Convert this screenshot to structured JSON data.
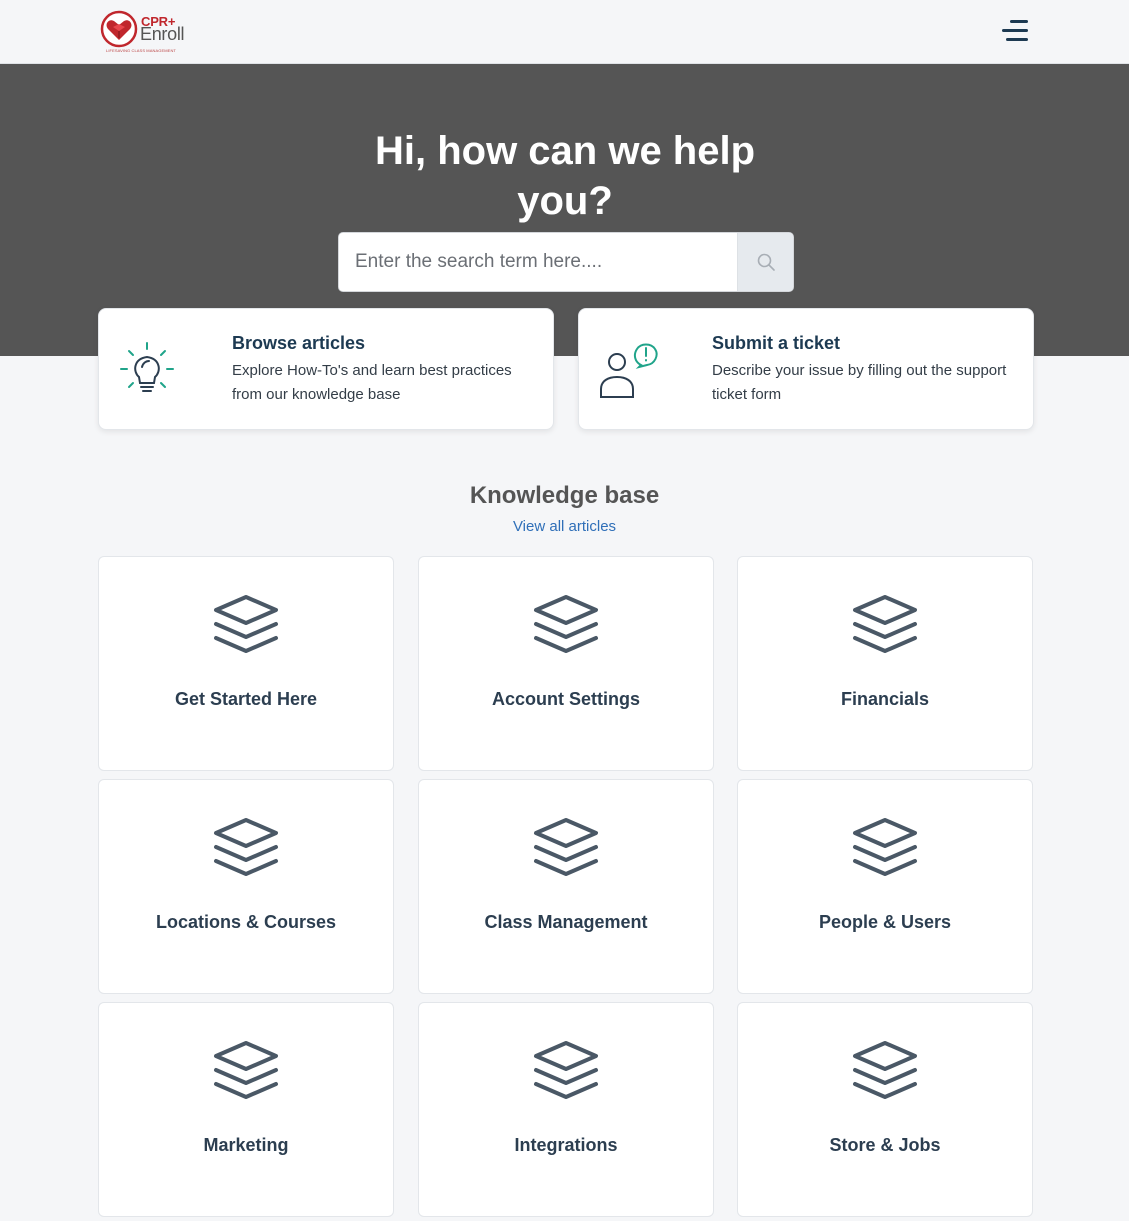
{
  "header": {
    "logo": {
      "brand_top": "CPR+",
      "brand_main": "Enroll",
      "tagline": "LIFESAVING CLASS MANAGEMENT",
      "icon": "heart-logo-icon"
    },
    "menu_icon": "hamburger-menu-icon"
  },
  "hero": {
    "title": "Hi, how can we help you?",
    "search": {
      "placeholder": "Enter the search term here....",
      "value": "",
      "icon": "search-icon"
    },
    "background_color": "#555555"
  },
  "actions": [
    {
      "title": "Browse articles",
      "description": "Explore How-To's and learn best practices from our knowledge base",
      "icon": "lightbulb-icon"
    },
    {
      "title": "Submit a ticket",
      "description": "Describe your issue by filling out the support ticket form",
      "icon": "user-alert-icon"
    }
  ],
  "knowledge_base": {
    "heading": "Knowledge base",
    "view_all": "View all articles",
    "categories": [
      {
        "label": "Get Started Here",
        "icon": "layers-icon"
      },
      {
        "label": "Account Settings",
        "icon": "layers-icon"
      },
      {
        "label": "Financials",
        "icon": "layers-icon"
      },
      {
        "label": "Locations & Courses",
        "icon": "layers-icon"
      },
      {
        "label": "Class Management",
        "icon": "layers-icon"
      },
      {
        "label": "People & Users",
        "icon": "layers-icon"
      },
      {
        "label": "Marketing",
        "icon": "layers-icon"
      },
      {
        "label": "Integrations",
        "icon": "layers-icon"
      },
      {
        "label": "Store & Jobs",
        "icon": "layers-icon"
      }
    ]
  },
  "colors": {
    "accent_teal": "#20a48a",
    "brand_red": "#c0272d",
    "heading_navy": "#1d3a52",
    "link_blue": "#2f6fb8",
    "icon_slate": "#4a5866"
  }
}
